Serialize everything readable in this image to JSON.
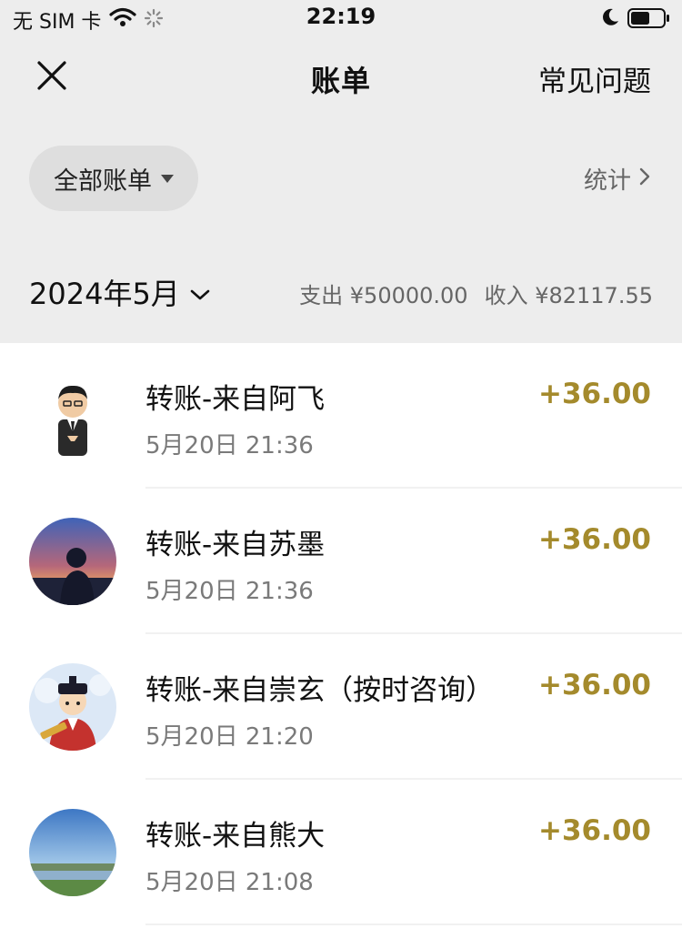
{
  "status_bar": {
    "carrier": "无 SIM 卡",
    "time": "22:19"
  },
  "nav": {
    "title": "账单",
    "faq": "常见问题"
  },
  "filter": {
    "label": "全部账单",
    "stats": "统计"
  },
  "month": {
    "label": "2024年5月",
    "expense": "支出 ¥50000.00",
    "income": "收入 ¥82117.55"
  },
  "transactions": [
    {
      "title": "转账-来自阿飞",
      "time": "5月20日 21:36",
      "amount": "+36.00"
    },
    {
      "title": "转账-来自苏墨",
      "time": "5月20日 21:36",
      "amount": "+36.00"
    },
    {
      "title": "转账-来自崇玄（按时咨询）",
      "time": "5月20日 21:20",
      "amount": "+36.00"
    },
    {
      "title": "转账-来自熊大",
      "time": "5月20日 21:08",
      "amount": "+36.00"
    }
  ],
  "colors": {
    "background": "#ededed",
    "amount": "#a48a2c"
  }
}
